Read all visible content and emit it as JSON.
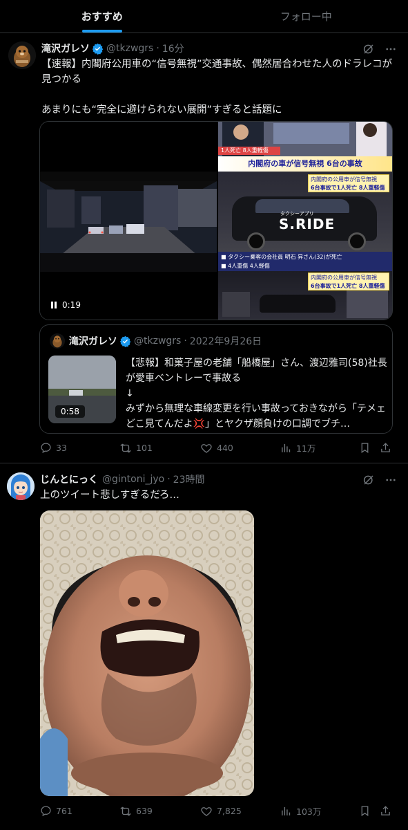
{
  "tabs": [
    {
      "label": "おすすめ"
    },
    {
      "label": "フォロー中"
    }
  ],
  "post1": {
    "display_name": "滝沢ガレソ",
    "handle": "@tkzwgrs",
    "time": "16分",
    "text": "【速報】内閣府公用車の“信号無視”交通事故、偶然居合わせた人のドラレコが見つかる\n\nあまりにも“完全に避けられない展開”すぎると話題に",
    "video_time": "0:19",
    "news_image": {
      "caption_top": "1人死亡 8人重軽傷",
      "banner": "内閣府の車が信号無視 6台の事故",
      "sub1": "内閣府の公用車が信号無視",
      "sub2": "6台事故で1人死亡 8人重軽傷",
      "taxi": "S.RIDE",
      "taxi_small": "タクシーアプリ",
      "bullet1": "■ タクシー乗客の会社員 明石 昇さん(32)が死亡",
      "bullet2": "■ 4人重傷 4人軽傷",
      "sub3": "内閣府の公用車が信号無視",
      "sub4": "6台事故で1人死亡 8人重軽傷"
    },
    "quote": {
      "display_name": "滝沢ガレソ",
      "handle": "@tkzwgrs",
      "date": "2022年9月26日",
      "text": "【悲報】和菓子屋の老舗「船橋屋」さん、渡辺雅司(58)社長が愛車ベントレーで事故る\n↓\nみずから無理な車線変更を行い事故っておきながら「テメェどこ見てんだよ💢」とヤクザ顔負けの口調でブチ…",
      "video_time": "0:58"
    },
    "stats": {
      "replies": "33",
      "retweets": "101",
      "likes": "440",
      "views": "11万"
    }
  },
  "post2": {
    "display_name": "じんとにっく",
    "handle": "@gintoni_jyo",
    "time": "23時間",
    "text": "上のツイート悲しすぎるだろ…",
    "stats": {
      "replies": "761",
      "retweets": "639",
      "likes": "7,825",
      "views": "103万"
    }
  },
  "colors": {
    "accent": "#1d9bf0",
    "muted": "#71767b",
    "border": "#2f3336",
    "background": "#000000"
  }
}
